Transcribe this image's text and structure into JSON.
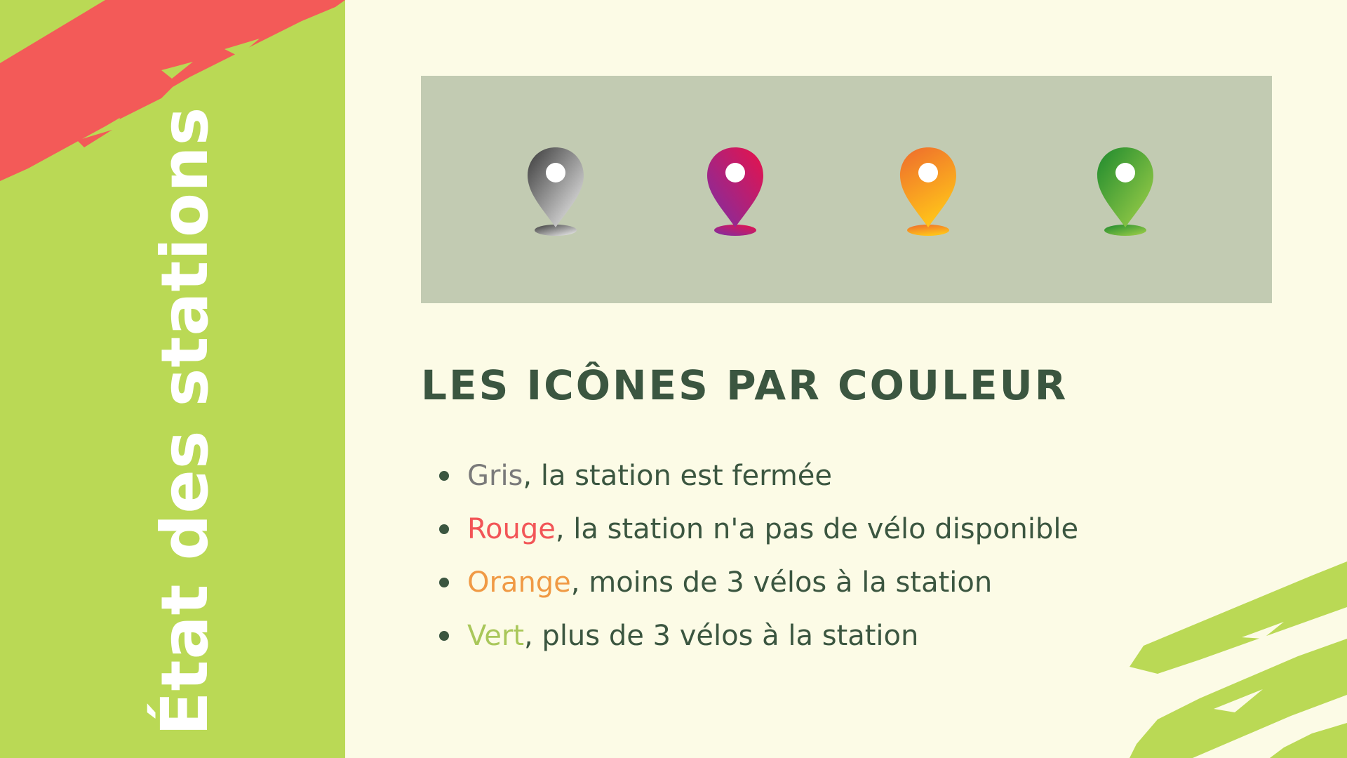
{
  "sidebar": {
    "title": "État des stations",
    "color": "#bad955",
    "stroke_color": "#f35a58"
  },
  "pins": [
    {
      "name": "grey-pin-icon",
      "color_top": "#3a3a3a",
      "color_bottom": "#f4f4f4"
    },
    {
      "name": "red-pin-icon",
      "color_top": "#e8124a",
      "color_bottom": "#7b2fa6"
    },
    {
      "name": "orange-pin-icon",
      "color_top": "#ee6b2d",
      "color_bottom": "#ffc21a"
    },
    {
      "name": "green-pin-icon",
      "color_top": "#1e8a2e",
      "color_bottom": "#a4d24a"
    }
  ],
  "heading": "LES ICÔNES PAR COULEUR",
  "legend": [
    {
      "keyword": "Gris",
      "text": ", la station est fermée",
      "color": "#7a7a7a"
    },
    {
      "keyword": "Rouge",
      "text": ", la station n'a pas de vélo disponible",
      "color": "#f25557"
    },
    {
      "keyword": "Orange",
      "text": ", moins de 3 vélos à la station",
      "color": "#f09a45"
    },
    {
      "keyword": "Vert",
      "text": ", plus de 3 vélos à la station",
      "color": "#a9c75a"
    }
  ],
  "colors": {
    "background": "#fcfbe6",
    "text": "#3b5640",
    "panel": "#c2cbb2",
    "accent_green": "#bad955"
  }
}
